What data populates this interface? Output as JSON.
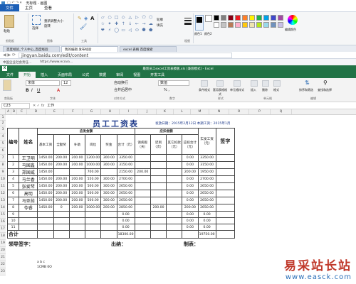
{
  "paint": {
    "title": "无标题 - 画图",
    "tabs": [
      "文件",
      "主页",
      "查看"
    ],
    "groups": [
      "剪贴板",
      "图像",
      "工具",
      "形状",
      "粗细",
      "颜色1",
      "颜色2",
      "编辑颜色"
    ],
    "tools": [
      "粘贴",
      "选择",
      "重新调整大小",
      "旋转",
      "刷子",
      "轮廓",
      "填充"
    ],
    "shapes": [
      "▱",
      "○",
      "□",
      "◇",
      "△",
      "▷",
      "⬠",
      "⬡",
      "☆",
      "✦",
      "✚",
      "↑",
      "↓",
      "←",
      "→",
      "☁",
      "❤",
      "⚡",
      "◯",
      "▭",
      "◁",
      "⬭",
      "⯃",
      "⬟"
    ],
    "palette": [
      "#000000",
      "#7f7f7f",
      "#880015",
      "#ed1c24",
      "#ff7f27",
      "#fff200",
      "#22b14c",
      "#00a2e8",
      "#3f48cc",
      "#a349a4",
      "#ffffff",
      "#c3c3c3",
      "#b97a57",
      "#ffaec9",
      "#ffc90e",
      "#efe4b0",
      "#b5e61d",
      "#99d9ea",
      "#7092be",
      "#c8bfe7"
    ]
  },
  "browser": {
    "tabs": [
      "百度经验_个人中心_百度经验",
      "我的编辑 发布经验",
      "excel 表格 百度搜索"
    ],
    "url": "jingyan.baidu.com/edit/content",
    "bookmarks": [
      "中国企业社会责任...",
      "https://www.ecova..."
    ]
  },
  "excel": {
    "title": "最新员工excel工资表模板.xls [兼容模式] - Excel",
    "tabs": [
      "文件",
      "开始",
      "插入",
      "页面布局",
      "公式",
      "数据",
      "审阅",
      "视图",
      "开发工具"
    ],
    "font": "宋体",
    "font_size": "12",
    "number_format": "数值",
    "ribbon_labels": {
      "wrap": "自动换行",
      "merge": "合并后居中",
      "cond": "条件格式",
      "fmt_table": "套用表格格式",
      "cell_style": "单元格样式",
      "insert": "插入",
      "delete": "删除",
      "format": "格式",
      "sort": "排序和筛选",
      "find": "查找和选择"
    },
    "sections": [
      "剪贴板",
      "字体",
      "对齐方式",
      "数字",
      "样式",
      "单元格",
      "编辑"
    ],
    "name_box": "C23",
    "formula": "工作",
    "columns": [
      "A",
      "B",
      "C",
      "D",
      "E",
      "F",
      "G",
      "H",
      "I",
      "J",
      "K",
      "L",
      "M",
      "N",
      "O",
      "P",
      "Q"
    ],
    "row_numbers": [
      "1",
      "2",
      "3",
      "4",
      "5",
      "6",
      "7",
      "8",
      "9",
      "10",
      "11",
      "12",
      "13",
      "14",
      "15",
      "16",
      "17",
      "18",
      "19",
      "20",
      "21",
      "22",
      "23"
    ],
    "sheet": {
      "title": "员工工资表",
      "date_label": "发放日期：2015年2月12日  本期工资：2015年1月",
      "col_headers": {
        "no": "编号",
        "name": "姓名",
        "should": "应发金额",
        "deduct": "应扣金额",
        "actual": "实发工资（元）",
        "sign": "签字",
        "sub": [
          "基本工资",
          "全勤奖",
          "补助",
          "岗位",
          "奖金",
          "合计（元）",
          "请病假（天）",
          "迟到（次）",
          "其它扣款（元）",
          "应扣合计（元）"
        ]
      },
      "rows": [
        {
          "no": "1",
          "name": "王卫明",
          "v": [
            "1450.00",
            "200.00",
            "200.00",
            "1200.00",
            "300.00",
            "3350.00",
            "",
            "",
            "",
            "0.00",
            "3350.00"
          ]
        },
        {
          "no": "2",
          "name": "马国鑫",
          "v": [
            "1450.00",
            "200.00",
            "200.00",
            "1000.00",
            "300.00",
            "3150.00",
            "",
            "",
            "",
            "0.00",
            "3150.00"
          ]
        },
        {
          "no": "3",
          "name": "郑国威",
          "v": [
            "1450.00",
            "",
            "",
            "700.00",
            "",
            "2150.00",
            "200.00",
            "",
            "",
            "200.00",
            "1950.00"
          ]
        },
        {
          "no": "4",
          "name": "马兰香",
          "v": [
            "1450.00",
            "200.00",
            "200.00",
            "550.00",
            "300.00",
            "2700.00",
            "",
            "",
            "",
            "0.00",
            "2700.00"
          ]
        },
        {
          "no": "5",
          "name": "张爱琴",
          "v": [
            "1450.00",
            "200.00",
            "200.00",
            "500.00",
            "300.00",
            "2650.00",
            "",
            "",
            "",
            "0.00",
            "2650.00"
          ]
        },
        {
          "no": "6",
          "name": "高明",
          "v": [
            "1450.00",
            "200.00",
            "200.00",
            "500.00",
            "300.00",
            "2650.00",
            "",
            "",
            "",
            "0.00",
            "2650.00"
          ]
        },
        {
          "no": "7",
          "name": "马亚茹",
          "v": [
            "1450.00",
            "200.00",
            "200.00",
            "500.00",
            "300.00",
            "2650.00",
            "",
            "",
            "",
            "0.00",
            "2650.00"
          ]
        },
        {
          "no": "8",
          "name": "苓睿",
          "v": [
            "1450.00",
            "0",
            "200.00",
            "1000.00",
            "200.00",
            "2850.00",
            "",
            "200.00",
            "",
            "200.00",
            "2650.00"
          ]
        },
        {
          "no": "9",
          "name": "",
          "v": [
            "",
            "",
            "",
            "",
            "",
            "0.00",
            "",
            "",
            "",
            "0.00",
            "0.00"
          ]
        },
        {
          "no": "10",
          "name": "",
          "v": [
            "",
            "",
            "",
            "",
            "",
            "0.00",
            "",
            "",
            "",
            "0.00",
            "0.00"
          ]
        },
        {
          "no": "11",
          "name": "",
          "v": [
            "",
            "",
            "",
            "",
            "",
            "0.00",
            "",
            "",
            "",
            "0.00",
            "0.00"
          ]
        }
      ],
      "total_label": "合计",
      "total_values": [
        "18300.00",
        "19750.00"
      ],
      "sign_leader": "领导签字：",
      "sign_cashier": "出纳：",
      "sign_maker": "制表：",
      "stray_text": [
        "a b c",
        "1CMB 0O"
      ]
    }
  },
  "watermark": {
    "cn": "易采站长站",
    "url": "www.easck.com"
  }
}
